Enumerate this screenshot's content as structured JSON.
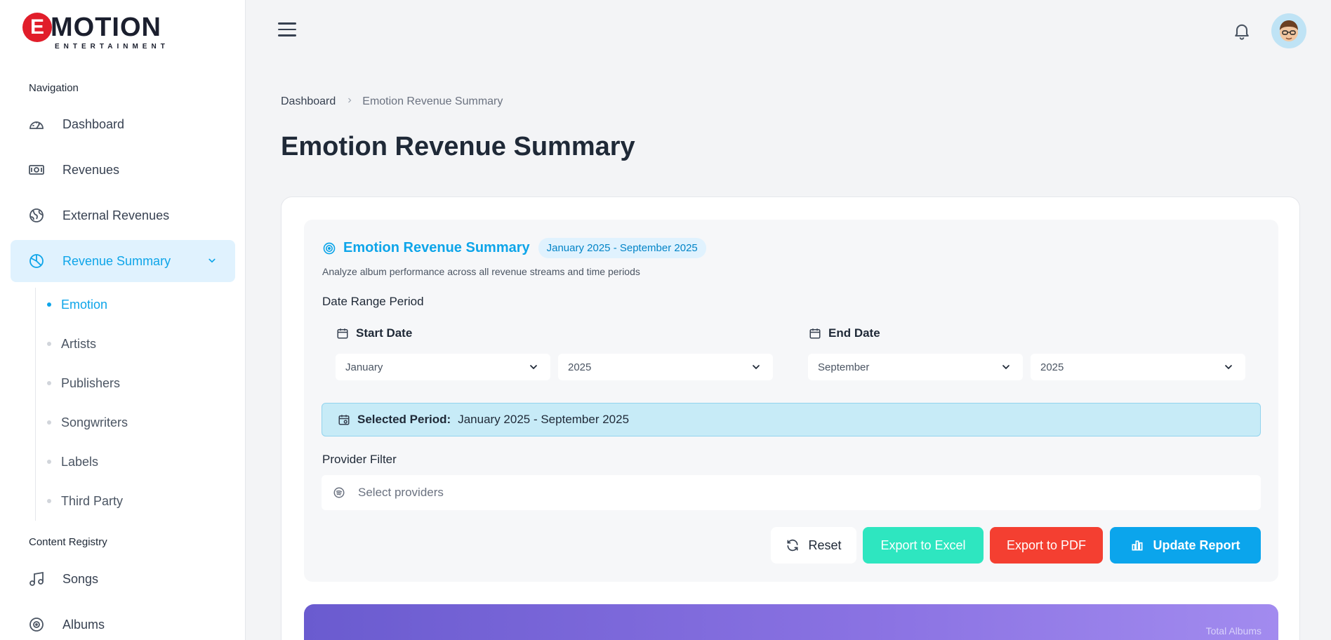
{
  "brand": {
    "initial": "E",
    "word": "MOTION",
    "sub": "ENTERTAINMENT"
  },
  "sidebar": {
    "navigation_title": "Navigation",
    "items": [
      {
        "label": "Dashboard",
        "icon": "gauge-icon"
      },
      {
        "label": "Revenues",
        "icon": "banknote-icon"
      },
      {
        "label": "External Revenues",
        "icon": "globe-icon"
      },
      {
        "label": "Revenue Summary",
        "icon": "pie-chart-icon",
        "active": true
      }
    ],
    "sub_items": [
      {
        "label": "Emotion",
        "active": true
      },
      {
        "label": "Artists"
      },
      {
        "label": "Publishers"
      },
      {
        "label": "Songwriters"
      },
      {
        "label": "Labels"
      },
      {
        "label": "Third Party"
      }
    ],
    "content_title": "Content Registry",
    "content_items": [
      {
        "label": "Songs",
        "icon": "music-note-icon"
      },
      {
        "label": "Albums",
        "icon": "disc-icon"
      }
    ]
  },
  "breadcrumb": {
    "home": "Dashboard",
    "current": "Emotion Revenue Summary"
  },
  "page": {
    "title": "Emotion Revenue Summary"
  },
  "panel": {
    "title": "Emotion Revenue Summary",
    "badge": "January 2025 - September 2025",
    "description": "Analyze album performance across all revenue streams and time periods",
    "date_range_label": "Date Range Period",
    "start_label": "Start Date",
    "start_month": "January",
    "start_year": "2025",
    "end_label": "End Date",
    "end_month": "September",
    "end_year": "2025",
    "selected_period_key": "Selected Period:",
    "selected_period_value": "January 2025 - September 2025",
    "provider_label": "Provider Filter",
    "provider_placeholder": "Select providers"
  },
  "buttons": {
    "reset": "Reset",
    "excel": "Export to Excel",
    "pdf": "Export to PDF",
    "update": "Update Report"
  },
  "stat": {
    "label": "Total Albums"
  },
  "colors": {
    "accent": "#0ea5e9",
    "excel": "#2ee6c0",
    "pdf": "#f43f31",
    "update": "#0ba5ec",
    "brand_red": "#e11d2a"
  }
}
